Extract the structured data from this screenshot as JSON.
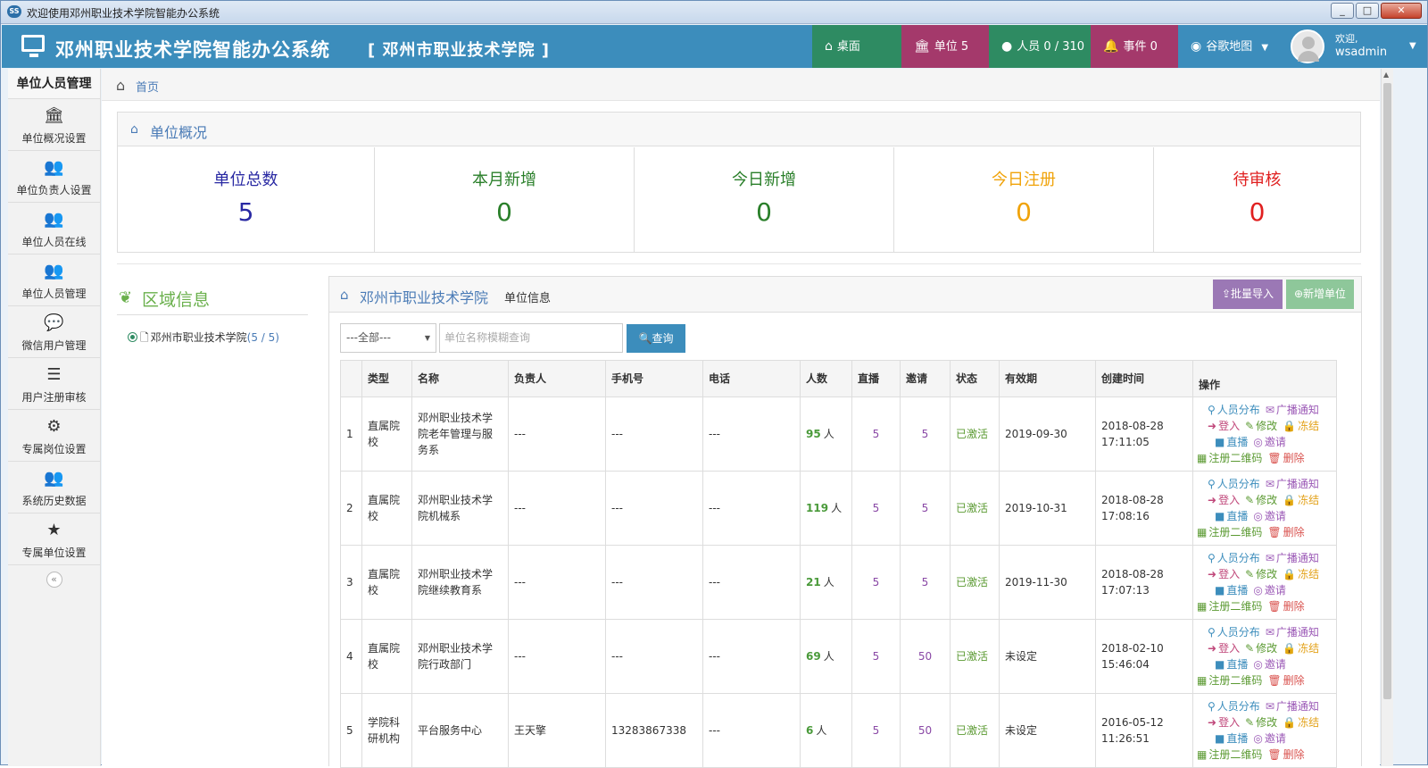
{
  "window": {
    "title": "欢迎使用邓州职业技术学院智能办公系统",
    "icon": "app-icon"
  },
  "header": {
    "brand": "邓州职业技术学院智能办公系统",
    "org": "[ 邓州市职业技术学院 ]",
    "nav": {
      "desk": "桌面",
      "unit": "单位 5",
      "people": "人员 0 / 310",
      "event": "事件 0",
      "map": "谷歌地图",
      "welcome": "欢迎,",
      "user": "wsadmin"
    },
    "colors": {
      "primary": "#3c8dbc",
      "green": "#2e8b62",
      "magenta": "#a4396b"
    }
  },
  "sidebar": {
    "title": "单位人员管理",
    "items": [
      {
        "label": "单位概况设置",
        "icon": "bank-icon"
      },
      {
        "label": "单位负责人设置",
        "icon": "users-icon"
      },
      {
        "label": "单位人员在线",
        "icon": "users-icon"
      },
      {
        "label": "单位人员管理",
        "icon": "users-icon"
      },
      {
        "label": "微信用户管理",
        "icon": "chat-icon"
      },
      {
        "label": "用户注册审核",
        "icon": "list-icon"
      },
      {
        "label": "专属岗位设置",
        "icon": "gears-icon"
      },
      {
        "label": "系统历史数据",
        "icon": "users-icon"
      },
      {
        "label": "专属单位设置",
        "icon": "star-icon"
      }
    ],
    "collapse": "«"
  },
  "breadcrumb": {
    "home": "首页"
  },
  "summary": {
    "title": "单位概况",
    "stats": [
      {
        "label": "单位总数",
        "value": "5",
        "color": "#2929a3"
      },
      {
        "label": "本月新增",
        "value": "0",
        "color": "#2a7f2a"
      },
      {
        "label": "今日新增",
        "value": "0",
        "color": "#2a7f2a"
      },
      {
        "label": "今日注册",
        "value": "0",
        "color": "#f0a30a"
      },
      {
        "label": "待审核",
        "value": "0",
        "color": "#e02020"
      }
    ]
  },
  "area": {
    "title": "区域信息",
    "node": "邓州市职业技术学院",
    "count": "(5 / 5)"
  },
  "units": {
    "title": "邓州市职业技术学院",
    "subtitle": "单位信息",
    "import_label": "批量导入",
    "add_label": "新增单位",
    "filter_select": "---全部---",
    "search_placeholder": "单位名称模糊查询",
    "query_label": "查询",
    "columns": [
      "类型",
      "名称",
      "负责人",
      "手机号",
      "电话",
      "人数",
      "直播",
      "邀请",
      "状态",
      "有效期",
      "创建时间",
      "操作"
    ],
    "rows": [
      {
        "idx": "1",
        "type": "直属院校",
        "name": "邓州职业技术学院老年管理与服务系",
        "leader": "---",
        "mobile": "---",
        "phone": "---",
        "count": "95",
        "unit": "人",
        "live": "5",
        "invite": "5",
        "status": "已激活",
        "expire": "2019-09-30",
        "created": "2018-08-28 17:11:05"
      },
      {
        "idx": "2",
        "type": "直属院校",
        "name": "邓州职业技术学院机械系",
        "leader": "---",
        "mobile": "---",
        "phone": "---",
        "count": "119",
        "unit": "人",
        "live": "5",
        "invite": "5",
        "status": "已激活",
        "expire": "2019-10-31",
        "created": "2018-08-28 17:08:16"
      },
      {
        "idx": "3",
        "type": "直属院校",
        "name": "邓州职业技术学院继续教育系",
        "leader": "---",
        "mobile": "---",
        "phone": "---",
        "count": "21",
        "unit": "人",
        "live": "5",
        "invite": "5",
        "status": "已激活",
        "expire": "2019-11-30",
        "created": "2018-08-28 17:07:13"
      },
      {
        "idx": "4",
        "type": "直属院校",
        "name": "邓州职业技术学院行政部门",
        "leader": "---",
        "mobile": "---",
        "phone": "---",
        "count": "69",
        "unit": "人",
        "live": "5",
        "invite": "50",
        "status": "已激活",
        "expire": "未设定",
        "created": "2018-02-10 15:46:04"
      },
      {
        "idx": "5",
        "type": "学院科研机构",
        "name": "平台服务中心",
        "leader": "王天擎",
        "mobile": "13283867338",
        "phone": "---",
        "count": "6",
        "unit": "人",
        "live": "5",
        "invite": "50",
        "status": "已激活",
        "expire": "未设定",
        "created": "2016-05-12 11:26:51"
      }
    ],
    "ops": {
      "distribution": "人员分布",
      "broadcast": "广播通知",
      "login": "登入",
      "edit": "修改",
      "freeze": "冻结",
      "live": "直播",
      "invite": "邀请",
      "qrcode": "注册二维码",
      "delete": "删除"
    }
  }
}
